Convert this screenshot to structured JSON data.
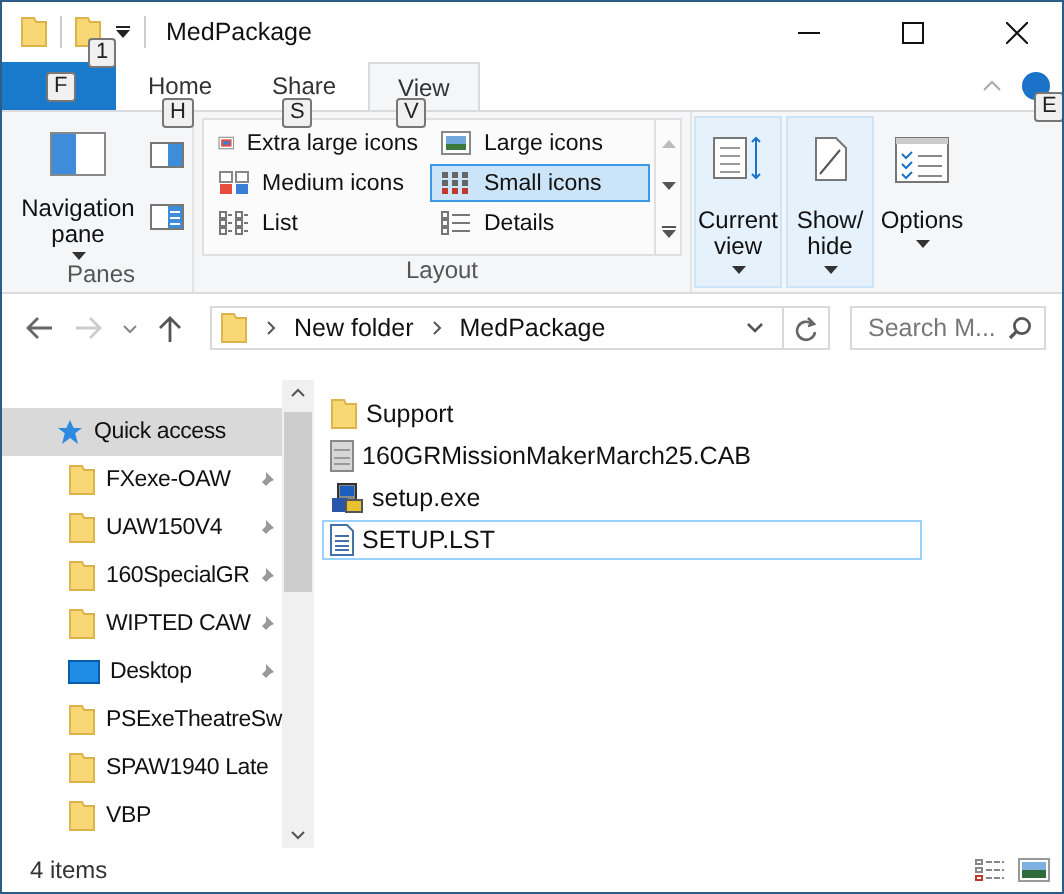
{
  "window": {
    "title": "MedPackage"
  },
  "quick_access_key_tip": "1",
  "file_tab": {
    "key_tip": "F"
  },
  "tabs": [
    {
      "label": "Home",
      "selected": false,
      "key_tip": "H"
    },
    {
      "label": "Share",
      "selected": false,
      "key_tip": "S"
    },
    {
      "label": "View",
      "selected": true,
      "key_tip": "V"
    }
  ],
  "help_key_tip": "E",
  "panes": {
    "navigation_pane": "Navigation pane",
    "label": "Panes"
  },
  "layout": {
    "label": "Layout",
    "options": [
      {
        "label": "Extra large icons",
        "kind": "xlarge",
        "selected": false
      },
      {
        "label": "Large icons",
        "kind": "large",
        "selected": false
      },
      {
        "label": "Medium icons",
        "kind": "medium",
        "selected": false
      },
      {
        "label": "Small icons",
        "kind": "small",
        "selected": true
      },
      {
        "label": "List",
        "kind": "list",
        "selected": false
      },
      {
        "label": "Details",
        "kind": "details",
        "selected": false
      }
    ]
  },
  "big_buttons": [
    {
      "label": "Current view",
      "kind": "current",
      "highlighted": true
    },
    {
      "label": "Show/ hide",
      "kind": "showhide",
      "highlighted": true
    },
    {
      "label": "Options",
      "kind": "options",
      "highlighted": false
    }
  ],
  "address": {
    "path": [
      "New folder",
      "MedPackage"
    ]
  },
  "search": {
    "placeholder": "Search M..."
  },
  "nav_items": [
    {
      "label": "Quick access",
      "kind": "quick",
      "selected": true,
      "pinned": false
    },
    {
      "label": "FXexe-OAW",
      "kind": "folder",
      "selected": false,
      "pinned": true
    },
    {
      "label": "UAW150V4",
      "kind": "folder",
      "selected": false,
      "pinned": true
    },
    {
      "label": "160SpecialGR",
      "kind": "folder",
      "selected": false,
      "pinned": true
    },
    {
      "label": "WIPTED CAW",
      "kind": "folder",
      "selected": false,
      "pinned": true
    },
    {
      "label": "Desktop",
      "kind": "desktop",
      "selected": false,
      "pinned": true
    },
    {
      "label": "PSExeTheatreSw",
      "kind": "folder",
      "selected": false,
      "pinned": false
    },
    {
      "label": "SPAW1940 Late",
      "kind": "folder",
      "selected": false,
      "pinned": false
    },
    {
      "label": "VBP",
      "kind": "folder",
      "selected": false,
      "pinned": false
    }
  ],
  "files": [
    {
      "name": "Support",
      "kind": "folder",
      "focused": false
    },
    {
      "name": "160GRMissionMakerMarch25.CAB",
      "kind": "cab",
      "focused": false
    },
    {
      "name": "setup.exe",
      "kind": "exe",
      "focused": false
    },
    {
      "name": "SETUP.LST",
      "kind": "text",
      "focused": true
    }
  ],
  "status_bar": {
    "item_count": "4 items"
  }
}
